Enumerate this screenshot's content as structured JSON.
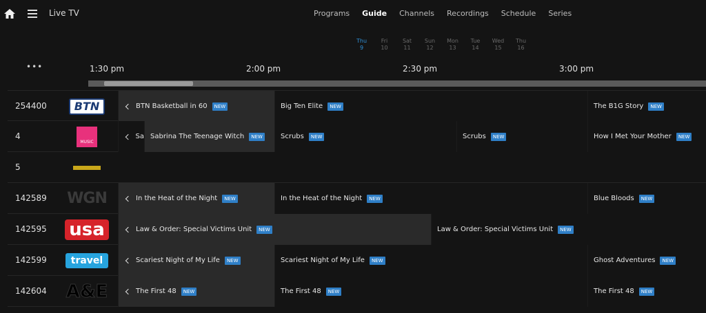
{
  "header": {
    "app_title": "Live TV",
    "nav": [
      {
        "label": "Programs",
        "active": false
      },
      {
        "label": "Guide",
        "active": true
      },
      {
        "label": "Channels",
        "active": false
      },
      {
        "label": "Recordings",
        "active": false
      },
      {
        "label": "Schedule",
        "active": false
      },
      {
        "label": "Series",
        "active": false
      }
    ]
  },
  "days": [
    {
      "name": "Thu",
      "num": "9"
    },
    {
      "name": "Fri",
      "num": "10"
    },
    {
      "name": "Sat",
      "num": "11"
    },
    {
      "name": "Sun",
      "num": "12"
    },
    {
      "name": "Mon",
      "num": "13"
    },
    {
      "name": "Tue",
      "num": "14"
    },
    {
      "name": "Wed",
      "num": "15"
    },
    {
      "name": "Thu",
      "num": "16"
    }
  ],
  "more": "•••",
  "times": [
    "1:30 pm",
    "2:00 pm",
    "2:30 pm",
    "3:00 pm"
  ],
  "badge": "NEW",
  "logos": {
    "btn": "BTN",
    "music": "MUSIC",
    "wgn": "WGN",
    "usa": "usa",
    "travel": "travel",
    "ae": "A&E"
  },
  "channels": [
    {
      "number": "254400",
      "logo": "btn",
      "programs": [
        {
          "title": "BTN Basketball in 60",
          "new": true,
          "shade": true,
          "chev": true
        },
        {
          "title": "Big Ten Elite",
          "new": true
        },
        {
          "title": "The B1G Story",
          "new": true
        }
      ]
    },
    {
      "number": "4",
      "logo": "music",
      "programs": [
        {
          "title": "Sa",
          "new": false,
          "shade": false,
          "chev": true
        },
        {
          "title": "Sabrina The Teenage Witch",
          "new": true,
          "shade": true
        },
        {
          "title": "Scrubs",
          "new": true
        },
        {
          "title": "Scrubs",
          "new": true
        },
        {
          "title": "How I Met Your Mother",
          "new": true
        }
      ]
    },
    {
      "number": "5",
      "logo": "yellow",
      "programs": []
    },
    {
      "number": "142589",
      "logo": "wgn",
      "programs": [
        {
          "title": "In the Heat of the Night",
          "new": true,
          "shade": true,
          "chev": true
        },
        {
          "title": "In the Heat of the Night",
          "new": true
        },
        {
          "title": "Blue Bloods",
          "new": true
        }
      ]
    },
    {
      "number": "142595",
      "logo": "usa",
      "programs": [
        {
          "title": "Law & Order: Special Victims Unit",
          "new": true,
          "shade": true,
          "chev": true
        },
        {
          "title": "Law & Order: Special Victims Unit",
          "new": true
        }
      ]
    },
    {
      "number": "142599",
      "logo": "travel",
      "programs": [
        {
          "title": "Scariest Night of My Life",
          "new": true,
          "shade": true,
          "chev": true
        },
        {
          "title": "Scariest Night of My Life",
          "new": true
        },
        {
          "title": "Ghost Adventures",
          "new": true
        }
      ]
    },
    {
      "number": "142604",
      "logo": "ae",
      "programs": [
        {
          "title": "The First 48",
          "new": true,
          "shade": true,
          "chev": true
        },
        {
          "title": "The First 48",
          "new": true
        },
        {
          "title": "The First 48",
          "new": true
        }
      ]
    }
  ],
  "colors": {
    "accent": "#2f8fd6",
    "badge": "#2f7fc7",
    "background": "#141414"
  }
}
